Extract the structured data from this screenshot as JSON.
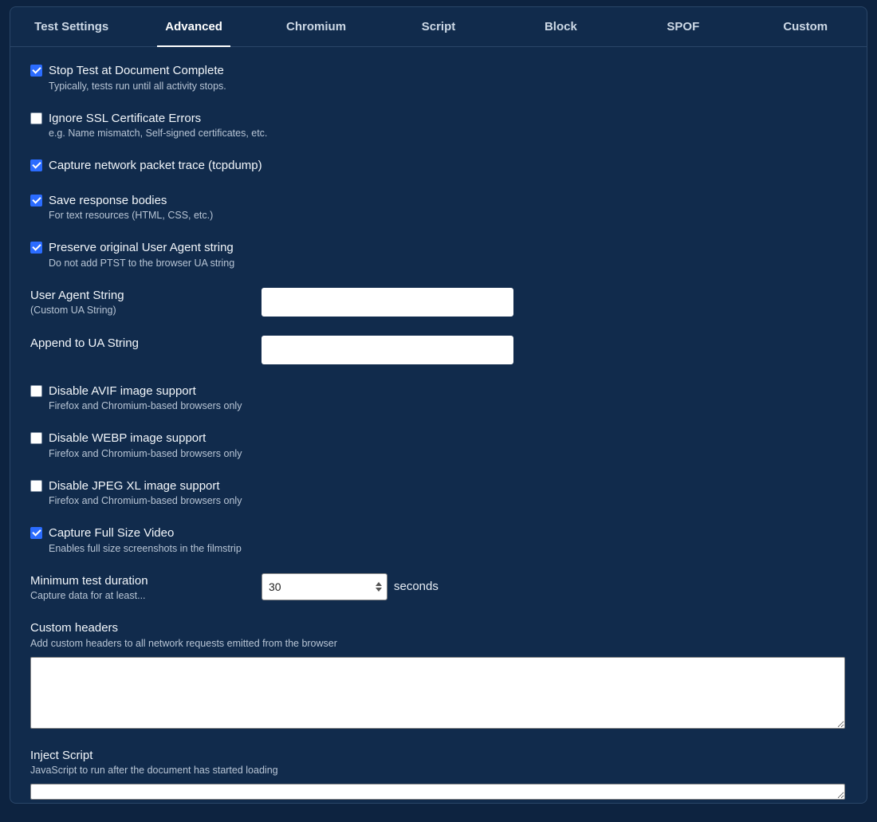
{
  "tabs": [
    {
      "label": "Test Settings",
      "active": false
    },
    {
      "label": "Advanced",
      "active": true
    },
    {
      "label": "Chromium",
      "active": false
    },
    {
      "label": "Script",
      "active": false
    },
    {
      "label": "Block",
      "active": false
    },
    {
      "label": "SPOF",
      "active": false
    },
    {
      "label": "Custom",
      "active": false
    }
  ],
  "opts": {
    "stop_doc": {
      "label": "Stop Test at Document Complete",
      "hint": "Typically, tests run until all activity stops.",
      "checked": true
    },
    "ignore_ssl": {
      "label": "Ignore SSL Certificate Errors",
      "hint": "e.g. Name mismatch, Self-signed certificates, etc.",
      "checked": false
    },
    "tcpdump": {
      "label": "Capture network packet trace (tcpdump)",
      "hint": "",
      "checked": true
    },
    "save_bodies": {
      "label": "Save response bodies",
      "hint": "For text resources (HTML, CSS, etc.)",
      "checked": true
    },
    "preserve_ua": {
      "label": "Preserve original User Agent string",
      "hint": "Do not add PTST to the browser UA string",
      "checked": true
    },
    "ua_string": {
      "label": "User Agent String",
      "hint": "(Custom UA String)",
      "value": ""
    },
    "append_ua": {
      "label": "Append to UA String",
      "hint": "",
      "value": ""
    },
    "disable_avif": {
      "label": "Disable AVIF image support",
      "hint": "Firefox and Chromium-based browsers only",
      "checked": false
    },
    "disable_webp": {
      "label": "Disable WEBP image support",
      "hint": "Firefox and Chromium-based browsers only",
      "checked": false
    },
    "disable_jxl": {
      "label": "Disable JPEG XL image support",
      "hint": "Firefox and Chromium-based browsers only",
      "checked": false
    },
    "full_video": {
      "label": "Capture Full Size Video",
      "hint": "Enables full size screenshots in the filmstrip",
      "checked": true
    },
    "min_duration": {
      "label": "Minimum test duration",
      "hint": "Capture data for at least...",
      "value": "30",
      "suffix": "seconds"
    },
    "custom_headers": {
      "label": "Custom headers",
      "hint": "Add custom headers to all network requests emitted from the browser",
      "value": ""
    },
    "inject_script": {
      "label": "Inject Script",
      "hint": "JavaScript to run after the document has started loading",
      "value": ""
    }
  }
}
